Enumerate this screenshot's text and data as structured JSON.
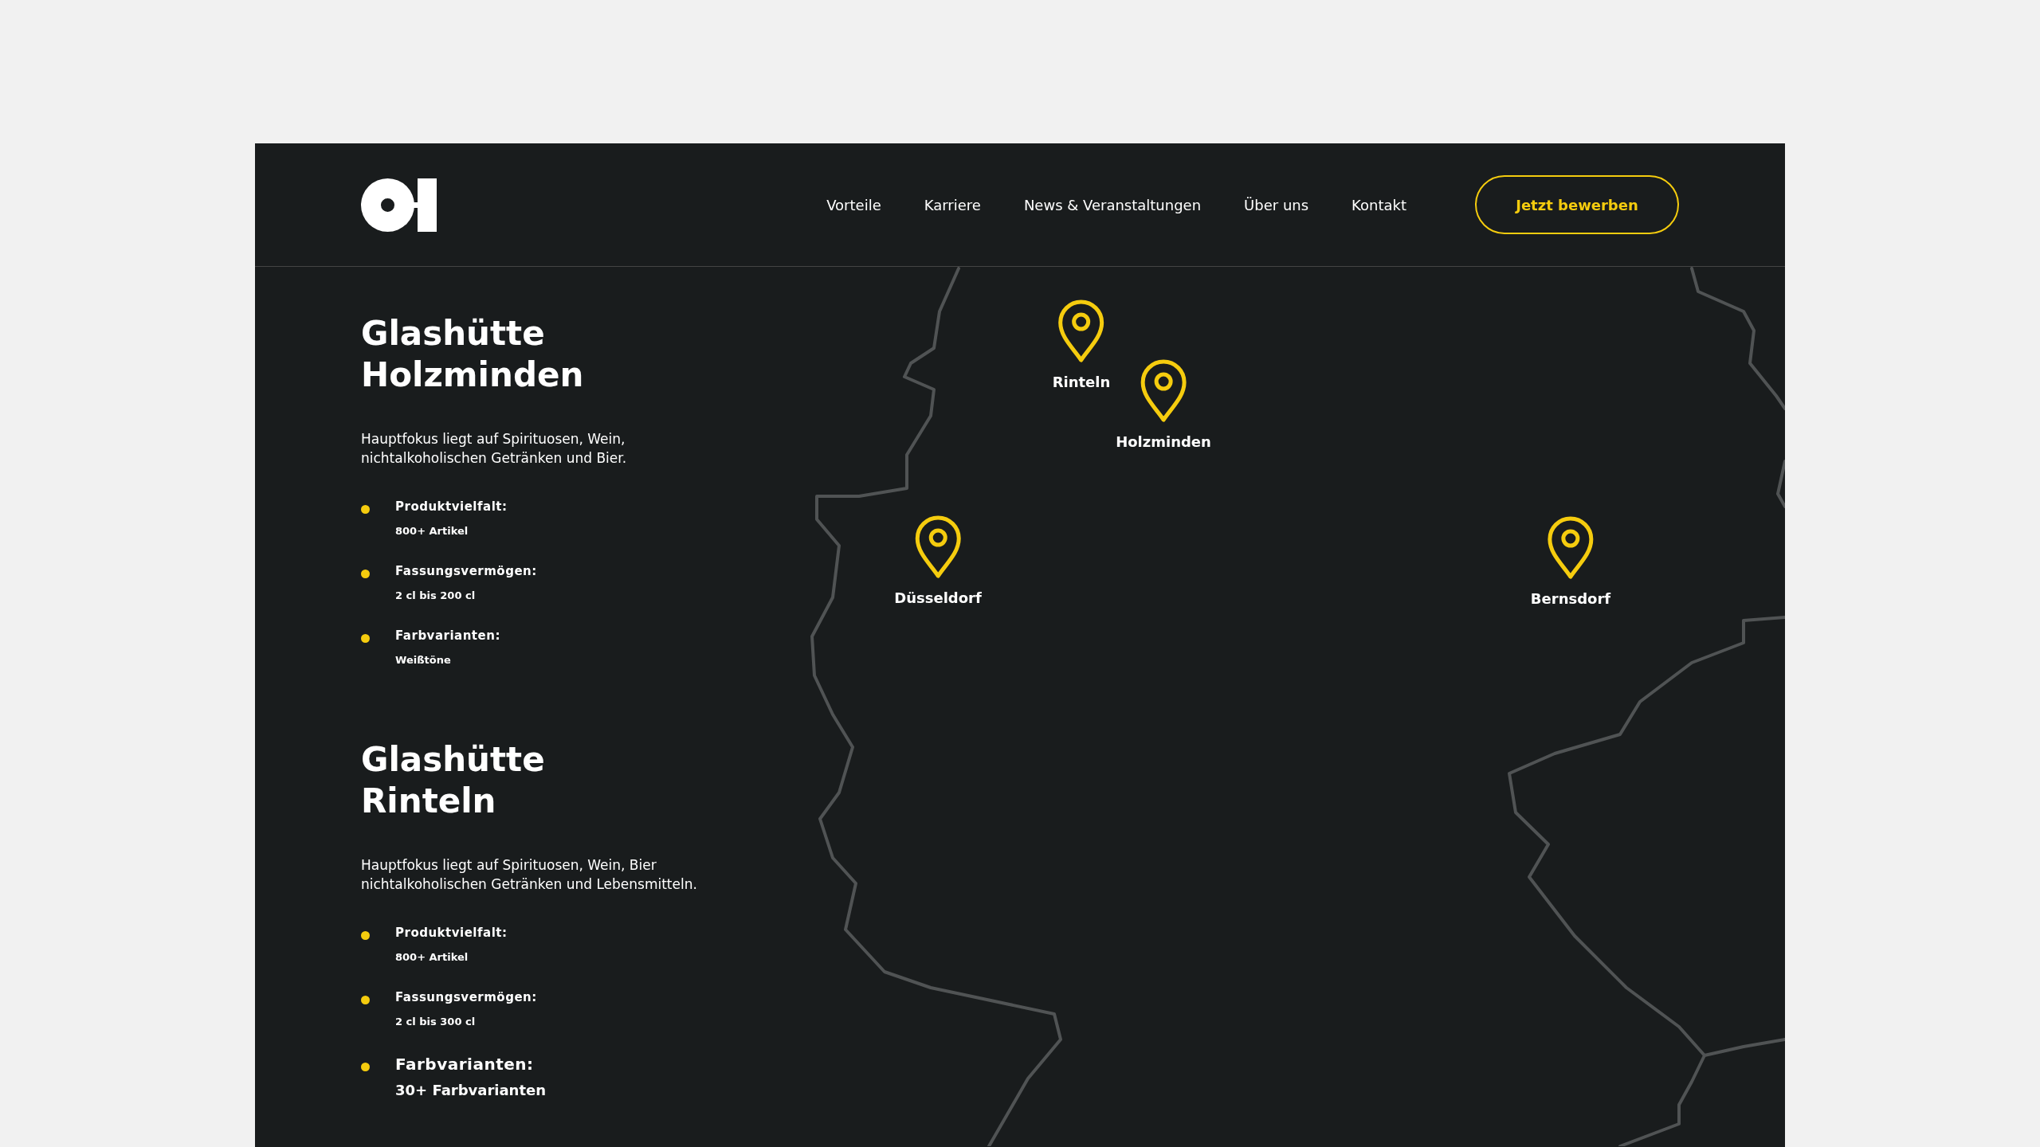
{
  "header": {
    "nav": [
      {
        "label": "Vorteile"
      },
      {
        "label": "Karriere"
      },
      {
        "label": "News & Veranstaltungen"
      },
      {
        "label": "Über uns"
      },
      {
        "label": "Kontakt"
      }
    ],
    "cta": "Jetzt bewerben"
  },
  "sections": [
    {
      "title_lines": [
        "Glashütte",
        "Holzminden"
      ],
      "description_lines": [
        "Hauptfokus liegt auf Spirituosen, Wein,",
        "nichtalkoholischen Getränken und Bier."
      ],
      "facts": [
        {
          "label": "Produktvielfalt:",
          "value": "800+ Artikel",
          "large": false
        },
        {
          "label": "Fassungsvermögen:",
          "value": "2 cl bis 200 cl",
          "large": false
        },
        {
          "label": "Farbvarianten:",
          "value": "Weißtöne",
          "large": false
        }
      ]
    },
    {
      "title_lines": [
        "Glashütte",
        "Rinteln"
      ],
      "description_lines": [
        "Hauptfokus liegt auf Spirituosen, Wein, Bier",
        "nichtalkoholischen Getränken und Lebensmitteln."
      ],
      "facts": [
        {
          "label": "Produktvielfalt:",
          "value": "800+ Artikel",
          "large": false
        },
        {
          "label": "Fassungsvermögen:",
          "value": "2 cl bis 300 cl",
          "large": false
        },
        {
          "label": "Farbvarianten:",
          "value": "30+ Farbvarianten",
          "large": true
        }
      ]
    }
  ],
  "map": {
    "pins": [
      {
        "label": "Rinteln"
      },
      {
        "label": "Holzminden"
      },
      {
        "label": "Düsseldorf"
      },
      {
        "label": "Bernsdorf"
      }
    ]
  }
}
